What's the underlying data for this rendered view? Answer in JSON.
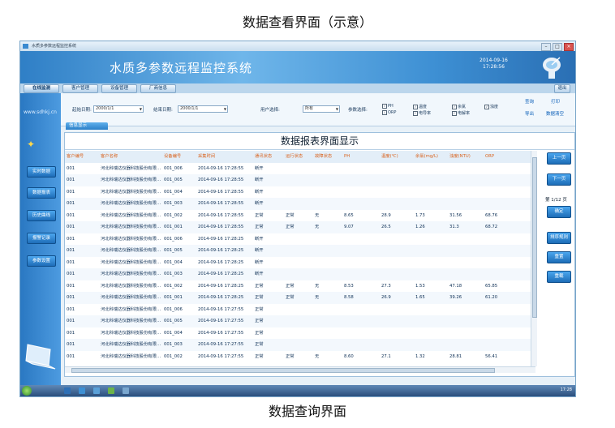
{
  "captions": {
    "top": "数据查看界面（示意）",
    "bottom": "数据查询界面"
  },
  "window": {
    "title": "水质多参数远程监控系统",
    "app_name": "水质多参数远程监控系统",
    "date": "2014-09-16",
    "time": "17:28:56"
  },
  "nav": {
    "tabs": [
      "在线监测",
      "客户管理",
      "设备管理",
      "厂商信息"
    ],
    "exit": "退出"
  },
  "sidebar": {
    "logo": "www.sdhkj.cn",
    "buttons": [
      "实时数据",
      "数据报表",
      "历史曲线",
      "报警记录",
      "参数设置"
    ]
  },
  "filter": {
    "start_label": "起始日期:",
    "start_value": "2000/1/1",
    "end_label": "结束日期:",
    "end_value": "2000/1/1",
    "user_label": "用户选择:",
    "user_value": "所有",
    "param_label": "参数选择:",
    "params": [
      "PH",
      "ORP",
      "温度",
      "电导率",
      "余氯",
      "电解率",
      "浊度"
    ],
    "links": [
      "查询",
      "打印",
      "导出",
      "数据清空"
    ]
  },
  "info_tab": "信息显示",
  "report_title": "数据报表界面显示",
  "table": {
    "headers": [
      "客户编号",
      "客户名称",
      "设备编号",
      "采集时间",
      "通讯状态",
      "运行状态",
      "故障状态",
      "PH",
      "温度(℃)",
      "余氯(mg/L)",
      "浊度(NTU)",
      "ORP"
    ],
    "rows": [
      [
        "001",
        "河北科瑞达仪器科技股份有限…",
        "001_006",
        "2014-09-16 17:28:55",
        "断开",
        "",
        "",
        "",
        "",
        "",
        "",
        ""
      ],
      [
        "001",
        "河北科瑞达仪器科技股份有限…",
        "001_005",
        "2014-09-16 17:28:55",
        "断开",
        "",
        "",
        "",
        "",
        "",
        "",
        ""
      ],
      [
        "001",
        "河北科瑞达仪器科技股份有限…",
        "001_004",
        "2014-09-16 17:28:55",
        "断开",
        "",
        "",
        "",
        "",
        "",
        "",
        ""
      ],
      [
        "001",
        "河北科瑞达仪器科技股份有限…",
        "001_003",
        "2014-09-16 17:28:55",
        "断开",
        "",
        "",
        "",
        "",
        "",
        "",
        ""
      ],
      [
        "001",
        "河北科瑞达仪器科技股份有限…",
        "001_002",
        "2014-09-16 17:28:55",
        "正常",
        "正常",
        "无",
        "8.65",
        "28.9",
        "1.73",
        "31.56",
        "68.76"
      ],
      [
        "001",
        "河北科瑞达仪器科技股份有限…",
        "001_001",
        "2014-09-16 17:28:55",
        "正常",
        "正常",
        "无",
        "9.07",
        "26.5",
        "1.26",
        "31.3",
        "68.72"
      ],
      [
        "001",
        "河北科瑞达仪器科技股份有限…",
        "001_006",
        "2014-09-16 17:28:25",
        "断开",
        "",
        "",
        "",
        "",
        "",
        "",
        ""
      ],
      [
        "001",
        "河北科瑞达仪器科技股份有限…",
        "001_005",
        "2014-09-16 17:28:25",
        "断开",
        "",
        "",
        "",
        "",
        "",
        "",
        ""
      ],
      [
        "001",
        "河北科瑞达仪器科技股份有限…",
        "001_004",
        "2014-09-16 17:28:25",
        "断开",
        "",
        "",
        "",
        "",
        "",
        "",
        ""
      ],
      [
        "001",
        "河北科瑞达仪器科技股份有限…",
        "001_003",
        "2014-09-16 17:28:25",
        "断开",
        "",
        "",
        "",
        "",
        "",
        "",
        ""
      ],
      [
        "001",
        "河北科瑞达仪器科技股份有限…",
        "001_002",
        "2014-09-16 17:28:25",
        "正常",
        "正常",
        "无",
        "8.53",
        "27.3",
        "1.53",
        "47.18",
        "65.85"
      ],
      [
        "001",
        "河北科瑞达仪器科技股份有限…",
        "001_001",
        "2014-09-16 17:28:25",
        "正常",
        "正常",
        "无",
        "8.58",
        "26.9",
        "1.65",
        "39.26",
        "61.20"
      ],
      [
        "001",
        "河北科瑞达仪器科技股份有限…",
        "001_006",
        "2014-09-16 17:27:55",
        "正常",
        "",
        "",
        "",
        "",
        "",
        "",
        ""
      ],
      [
        "001",
        "河北科瑞达仪器科技股份有限…",
        "001_005",
        "2014-09-16 17:27:55",
        "正常",
        "",
        "",
        "",
        "",
        "",
        "",
        ""
      ],
      [
        "001",
        "河北科瑞达仪器科技股份有限…",
        "001_004",
        "2014-09-16 17:27:55",
        "正常",
        "",
        "",
        "",
        "",
        "",
        "",
        ""
      ],
      [
        "001",
        "河北科瑞达仪器科技股份有限…",
        "001_003",
        "2014-09-16 17:27:55",
        "正常",
        "",
        "",
        "",
        "",
        "",
        "",
        ""
      ],
      [
        "001",
        "河北科瑞达仪器科技股份有限…",
        "001_002",
        "2014-09-16 17:27:55",
        "正常",
        "正常",
        "无",
        "8.60",
        "27.1",
        "1.32",
        "28.81",
        "56.41"
      ]
    ]
  },
  "right_buttons": {
    "up": "上一页",
    "down": "下一页",
    "page_prefix": "第",
    "page": "1/12",
    "page_suffix": "页",
    "confirm": "确定",
    "sort": "排序规则",
    "reset": "重置",
    "refresh": "重载"
  },
  "taskbar": {
    "clock": "17:28"
  }
}
